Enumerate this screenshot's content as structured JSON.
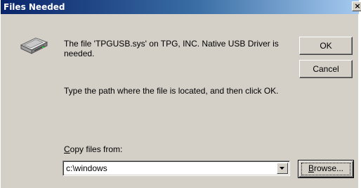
{
  "window": {
    "title": "Files Needed",
    "close_glyph": "×"
  },
  "icons": {
    "disk": "removable-disk-icon",
    "close": "close-icon",
    "dropdown": "chevron-down-icon"
  },
  "message": {
    "line1": "The file 'TPGUSB.sys' on TPG, INC. Native USB Driver is needed.",
    "line2": "Type the path where the file is located, and then click OK."
  },
  "buttons": {
    "ok": "OK",
    "cancel": "Cancel",
    "browse_accel": "B",
    "browse_rest": "rowse..."
  },
  "copy_from": {
    "label_accel": "C",
    "label_rest": "opy files from:",
    "value": "c:\\windows"
  },
  "colors": {
    "titlebar_start": "#0a246a",
    "titlebar_end": "#a6caf0",
    "face": "#d4d0c8"
  }
}
